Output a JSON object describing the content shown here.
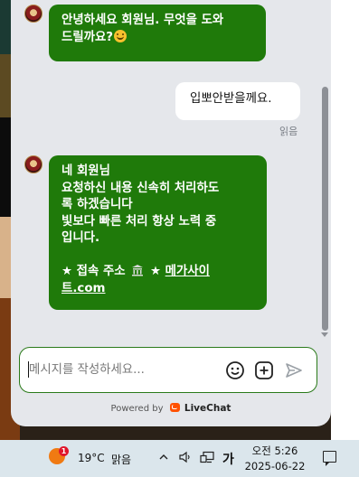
{
  "chat": {
    "messages": [
      {
        "role": "agent",
        "lines": [
          "안녕하세요 회원님. 무엇을 도와",
          "드릴까요?"
        ]
      },
      {
        "role": "user",
        "text": "입뽀안받을께요.",
        "status": "읽음"
      },
      {
        "role": "agent",
        "lines": [
          "네 회원님",
          "요청하신 내용 신속히 처리하도",
          "록 하겠습니다",
          "빛보다 빠른 처리 항상 노력 중",
          "입니다."
        ],
        "footer_prefix": "★ 접속 주소",
        "footer_star2": "★",
        "link_line1": "메가사이",
        "link_line2": "트.com"
      }
    ],
    "composer": {
      "placeholder": "메시지를 작성하세요..."
    },
    "powered_by": {
      "prefix": "Powered by",
      "brand": "LiveChat"
    }
  },
  "taskbar": {
    "weather": {
      "badge": "1",
      "temp": "19°C",
      "condition": "맑음"
    },
    "ime": "가",
    "clock": {
      "time": "오전 5:26",
      "date": "2025-06-22"
    }
  },
  "colors": {
    "agent_bubble": "#1f7a0a",
    "composer_border": "#2a7a1a",
    "livechat_brand": "#ff5100"
  }
}
